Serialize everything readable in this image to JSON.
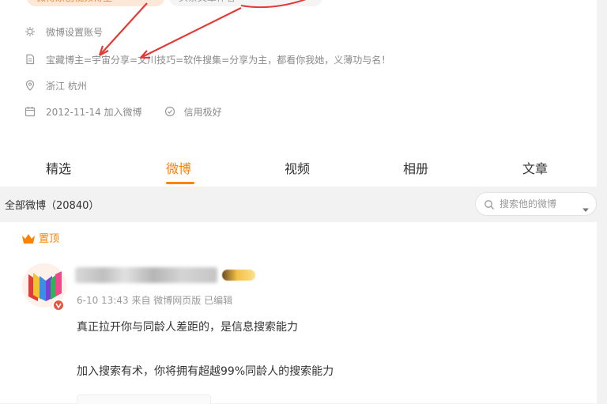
{
  "profile": {
    "tag_left": "微博原创视频博主",
    "tag_right": "头条文章作者",
    "info": [
      {
        "icon": "sun-icon",
        "text": "微博设置账号"
      },
      {
        "icon": "document-icon",
        "text": "宝藏博主=宇宙分享=文川技巧=软件搜集=分享为主，都看你我她，义薄功与名！"
      },
      {
        "icon": "location-icon",
        "text": "浙江 杭州"
      },
      {
        "icon": "calendar-icon",
        "text": "2012-11-14 加入微博"
      }
    ],
    "credit": {
      "icon": "credit-icon",
      "text": "信用极好"
    }
  },
  "tabs": [
    {
      "label": "精选",
      "active": false
    },
    {
      "label": "微博",
      "active": true
    },
    {
      "label": "视频",
      "active": false
    },
    {
      "label": "相册",
      "active": false
    },
    {
      "label": "文章",
      "active": false
    }
  ],
  "feed": {
    "title": "全部微博（20840）",
    "search_placeholder": "搜索他的微博"
  },
  "post": {
    "pinned_label": "置顶",
    "meta": "6-10 13:43  来自 微博网页版",
    "edited": "已编辑",
    "line1": "真正拉开你与同龄人差距的，是信息搜索能力",
    "line2": "加入搜索有术，你将拥有超越99%同龄人的搜索能力"
  },
  "colors": {
    "accent": "#ff8200",
    "annotation_red": "#e53935"
  }
}
